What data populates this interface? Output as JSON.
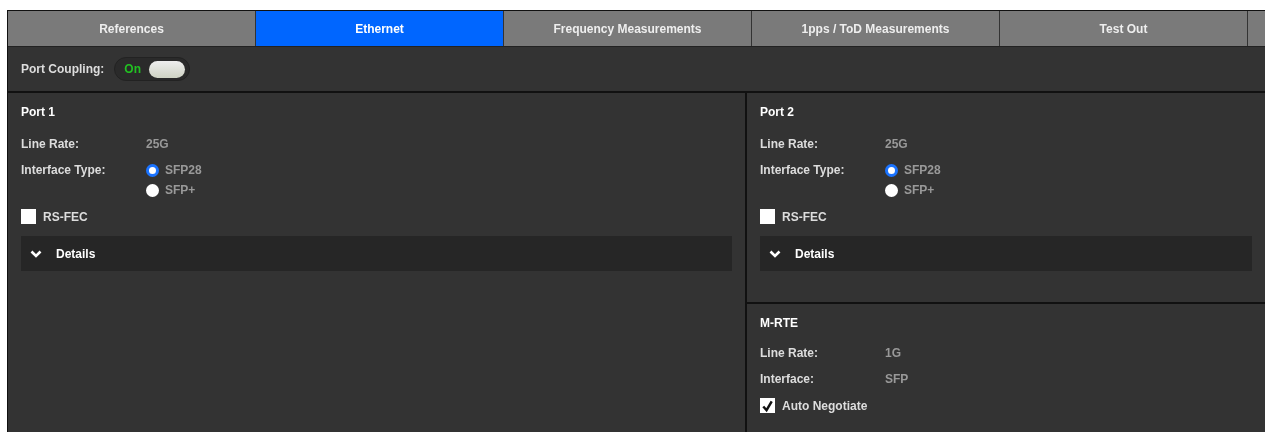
{
  "tabs": [
    {
      "label": "References",
      "selected": false
    },
    {
      "label": "Ethernet",
      "selected": true
    },
    {
      "label": "Frequency Measurements",
      "selected": false
    },
    {
      "label": "1pps / ToD Measurements",
      "selected": false
    },
    {
      "label": "Test Out",
      "selected": false
    }
  ],
  "port_coupling": {
    "label": "Port Coupling:",
    "toggle_text": "On",
    "on": true
  },
  "ports": [
    {
      "title": "Port 1",
      "line_rate_label": "Line Rate:",
      "line_rate": "25G",
      "interface_label": "Interface Type:",
      "options": [
        {
          "label": "SFP28",
          "selected": true
        },
        {
          "label": "SFP+",
          "selected": false
        }
      ],
      "rs_fec": {
        "label": "RS-FEC",
        "checked": false
      },
      "details": {
        "label": "Details",
        "expanded": false
      }
    },
    {
      "title": "Port 2",
      "line_rate_label": "Line Rate:",
      "line_rate": "25G",
      "interface_label": "Interface Type:",
      "options": [
        {
          "label": "SFP28",
          "selected": true
        },
        {
          "label": "SFP+",
          "selected": false
        }
      ],
      "rs_fec": {
        "label": "RS-FEC",
        "checked": false
      },
      "details": {
        "label": "Details",
        "expanded": false
      }
    }
  ],
  "mrte": {
    "title": "M-RTE",
    "rows": [
      {
        "label": "Line Rate:",
        "value": "1G"
      },
      {
        "label": "Interface:",
        "value": "SFP"
      }
    ],
    "auto_negotiate": {
      "label": "Auto Negotiate",
      "checked": true
    }
  }
}
